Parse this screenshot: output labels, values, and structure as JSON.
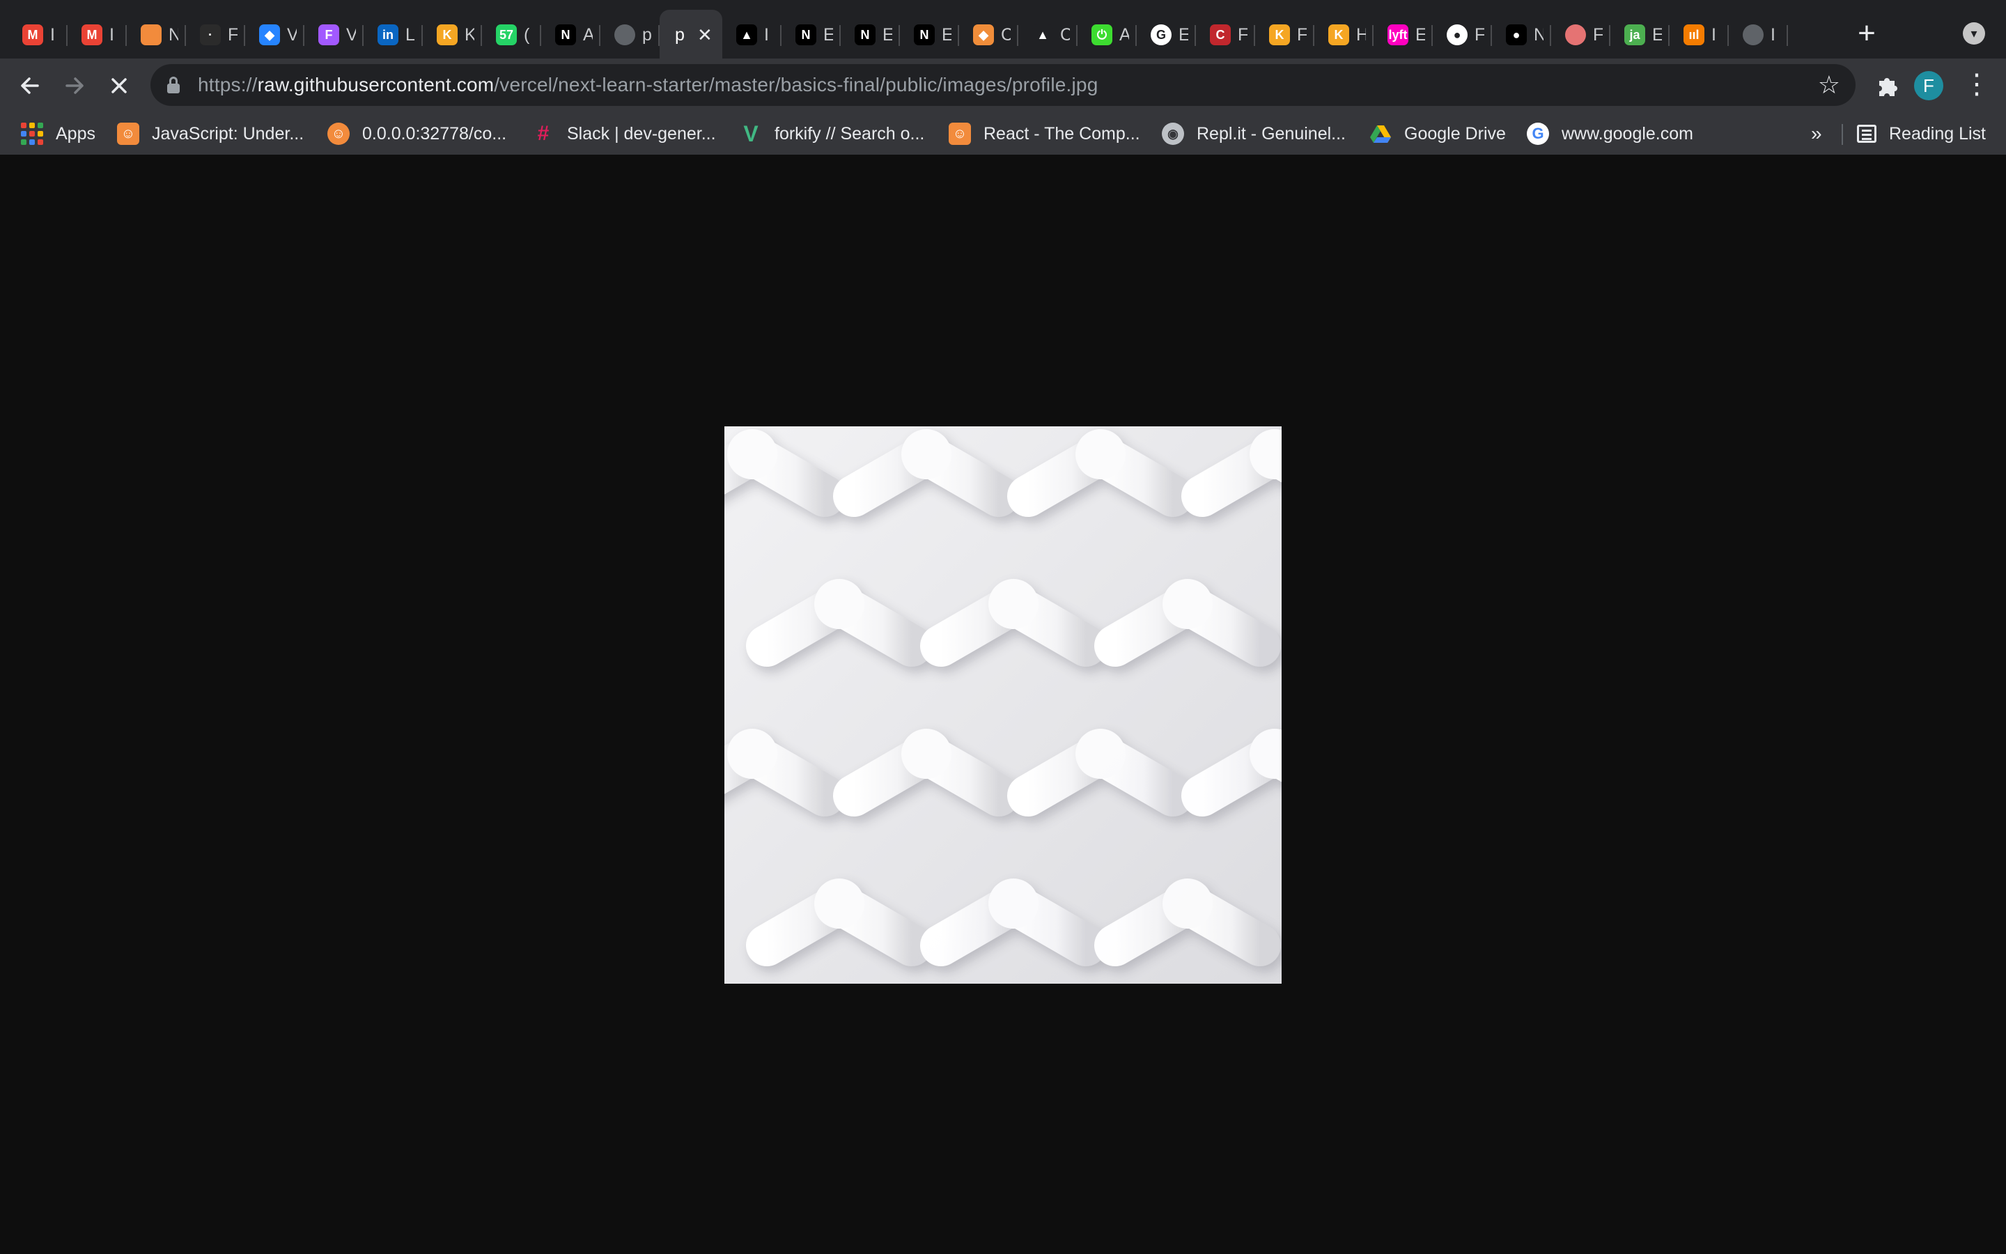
{
  "tabs": [
    {
      "icon": "gmail-icon",
      "letter": "M",
      "color": "#ea4335",
      "title": "I"
    },
    {
      "icon": "gmail-icon",
      "letter": "M",
      "color": "#ea4335",
      "title": "I"
    },
    {
      "icon": "avatar-orange-icon",
      "letter": "",
      "color": "#f28b3c",
      "title": "N"
    },
    {
      "icon": "dark-logo-icon",
      "letter": "·",
      "color": "#2b2b2b",
      "title": "F"
    },
    {
      "icon": "jira-icon",
      "letter": "◆",
      "color": "#2684ff",
      "title": "V"
    },
    {
      "icon": "figma-icon",
      "letter": "F",
      "color": "#a259ff",
      "title": "V"
    },
    {
      "icon": "linkedin-icon",
      "letter": "in",
      "color": "#0a66c2",
      "title": "L"
    },
    {
      "icon": "kongapay-icon",
      "letter": "K",
      "color": "#f5a623",
      "title": "K"
    },
    {
      "icon": "whatsapp-icon",
      "letter": "57",
      "color": "#25d366",
      "title": "("
    },
    {
      "icon": "nextjs-icon",
      "letter": "N",
      "color": "#000000",
      "title": "A"
    },
    {
      "icon": "globe-icon",
      "letter": "",
      "color": "#5f6368",
      "title": "p"
    },
    {
      "icon": "",
      "letter": "",
      "color": "",
      "title": "p",
      "active": true
    },
    {
      "icon": "vercel-icon",
      "letter": "▲",
      "color": "#000000",
      "title": "I"
    },
    {
      "icon": "nextjs-icon",
      "letter": "N",
      "color": "#000000",
      "title": "E"
    },
    {
      "icon": "nextjs-icon",
      "letter": "N",
      "color": "#000000",
      "title": "E"
    },
    {
      "icon": "nextjs-icon",
      "letter": "N",
      "color": "#000000",
      "title": "E"
    },
    {
      "icon": "package-icon",
      "letter": "◆",
      "color": "#f08d3a",
      "title": "C"
    },
    {
      "icon": "vercel-triangle-icon",
      "letter": "▲",
      "color": "#202124",
      "title": "C"
    },
    {
      "icon": "power-icon",
      "letter": "⏻",
      "color": "#3ddc30",
      "title": "A"
    },
    {
      "icon": "google-icon",
      "letter": "G",
      "color": "#ffffff",
      "title": "E"
    },
    {
      "icon": "codesandbox-icon",
      "letter": "C",
      "color": "#c1272d",
      "title": "F"
    },
    {
      "icon": "kongapay-icon",
      "letter": "K",
      "color": "#f5a623",
      "title": "F"
    },
    {
      "icon": "kongapay-icon",
      "letter": "K",
      "color": "#f5a623",
      "title": "H"
    },
    {
      "icon": "lyft-icon",
      "letter": "lyft",
      "color": "#ff00bf",
      "title": "E"
    },
    {
      "icon": "github-icon",
      "letter": "●",
      "color": "#ffffff",
      "title": "F"
    },
    {
      "icon": "dot-app-icon",
      "letter": "●",
      "color": "#000000",
      "title": "N"
    },
    {
      "icon": "red-circle-icon",
      "letter": "",
      "color": "#e57373",
      "title": "F"
    },
    {
      "icon": "flag-icon",
      "letter": "ja",
      "color": "#4caf50",
      "title": "E"
    },
    {
      "icon": "chart-icon",
      "letter": "ııl",
      "color": "#f57c00",
      "title": "I"
    },
    {
      "icon": "globe-icon",
      "letter": "",
      "color": "#5f6368",
      "title": "I"
    }
  ],
  "toolbar": {
    "url_prefix": "https://",
    "url_host": "raw.githubusercontent.com",
    "url_path": "/vercel/next-learn-starter/master/basics-final/public/images/profile.jpg",
    "avatar_letter": "F"
  },
  "bookmarks": [
    {
      "label": "Apps",
      "icon": "apps-grid-icon"
    },
    {
      "label": "JavaScript: Under...",
      "icon": "udemy-avatar-icon",
      "color": "#f28b3c"
    },
    {
      "label": "0.0.0.0:32778/co...",
      "icon": "orange-circle-icon",
      "color": "#f28b3c"
    },
    {
      "label": "Slack | dev-gener...",
      "icon": "slack-icon",
      "color": "#4a154b"
    },
    {
      "label": "forkify // Search o...",
      "icon": "vue-icon",
      "color": "#41b883"
    },
    {
      "label": "React - The Comp...",
      "icon": "udemy-avatar-icon",
      "color": "#f28b3c"
    },
    {
      "label": "Repl.it - Genuinel...",
      "icon": "replit-icon",
      "color": "#9aa0a6"
    },
    {
      "label": "Google Drive",
      "icon": "google-drive-icon",
      "color": "#fbbc04"
    },
    {
      "label": "www.google.com",
      "icon": "google-icon",
      "color": "#ffffff"
    }
  ],
  "more_bookmarks": "»",
  "reading_list": "Reading List",
  "colors": {
    "tabstrip": "#202124",
    "toolbar": "#35363a",
    "viewport": "#0e0e0e",
    "avatar": "#1e8ea0"
  }
}
